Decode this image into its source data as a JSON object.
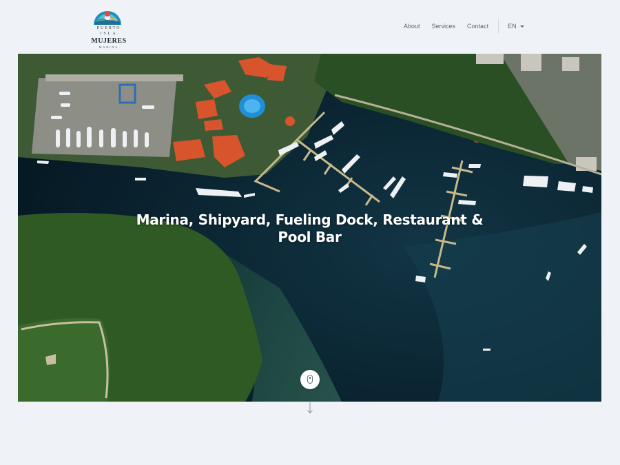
{
  "logo": {
    "line1": "PUERTO",
    "line2": "ISLA",
    "line3": "MUJERES",
    "line4": "MARINA"
  },
  "nav": {
    "items": [
      {
        "label": "About"
      },
      {
        "label": "Services"
      },
      {
        "label": "Contact"
      }
    ],
    "language": "EN"
  },
  "hero": {
    "title": "Marina, Shipyard, Fueling Dock, Restaurant & Pool Bar"
  },
  "icons": {
    "scroll": "mouse-icon",
    "arrow": "arrow-down-icon",
    "caret": "caret-down-icon"
  },
  "colors": {
    "background": "#eff3f8",
    "water": "#0b2432",
    "jungle": "#2f5a24",
    "roof": "#d8542c",
    "pool": "#1f8fd8"
  }
}
